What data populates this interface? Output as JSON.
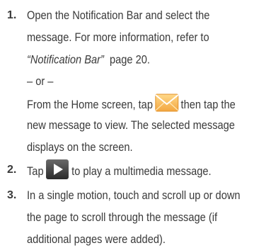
{
  "steps": [
    {
      "number": "1.",
      "lines": [
        "Open the Notification Bar and select the",
        "message. For more information, refer to",
        "page 20."
      ],
      "reference": "“Notification Bar”",
      "or": "– or –",
      "alt_before": "From the Home screen, tap",
      "alt_after": "then tap the",
      "alt_lines": [
        "new message to view. The selected message",
        "displays on the screen."
      ],
      "icon": "message-envelope-icon"
    },
    {
      "number": "2.",
      "before": "Tap",
      "after": "to play a multimedia message.",
      "icon": "play-icon"
    },
    {
      "number": "3.",
      "lines": [
        "In a single motion, touch and scroll up or down",
        "the page to scroll through the message (if",
        "additional pages were added)."
      ]
    }
  ]
}
